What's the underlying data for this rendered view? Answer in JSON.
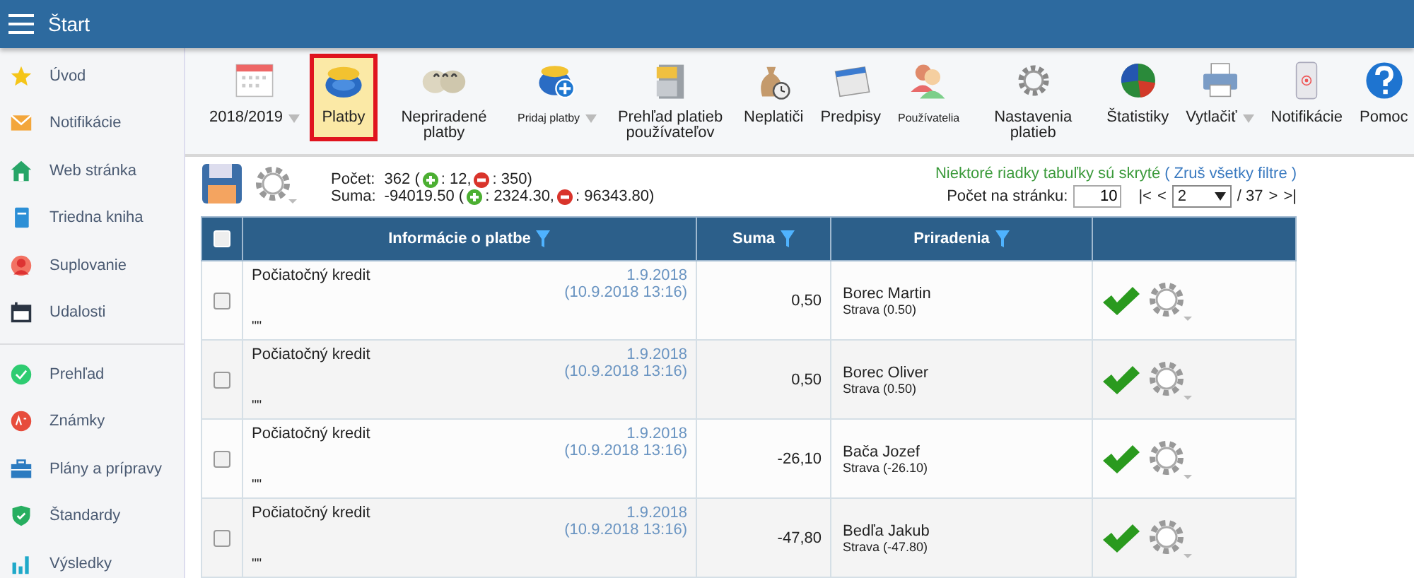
{
  "header": {
    "title": "Štart"
  },
  "sidebar": {
    "groups": [
      {
        "items": [
          {
            "label": "Úvod"
          },
          {
            "label": "Notifikácie"
          },
          {
            "label": "Web stránka"
          },
          {
            "label": "Triedna kniha"
          },
          {
            "label": "Suplovanie"
          },
          {
            "label": "Udalosti"
          }
        ]
      },
      {
        "items": [
          {
            "label": "Prehľad"
          },
          {
            "label": "Známky"
          },
          {
            "label": "Plány a prípravy"
          },
          {
            "label": "Štandardy"
          },
          {
            "label": "Výsledky"
          }
        ]
      }
    ]
  },
  "toolbar": [
    {
      "label": "2018/2019",
      "selected": false,
      "dropdown": true,
      "small": false
    },
    {
      "label": "Platby",
      "selected": true,
      "dropdown": false,
      "small": false
    },
    {
      "label": "Nepriradené platby",
      "selected": false,
      "dropdown": false,
      "small": false
    },
    {
      "label": "Pridaj platby",
      "selected": false,
      "dropdown": true,
      "small": true
    },
    {
      "label": "Prehľad platieb používateľov",
      "selected": false,
      "dropdown": false,
      "small": false
    },
    {
      "label": "Neplatiči",
      "selected": false,
      "dropdown": false,
      "small": false
    },
    {
      "label": "Predpisy",
      "selected": false,
      "dropdown": false,
      "small": false
    },
    {
      "label": "Používatelia",
      "selected": false,
      "dropdown": false,
      "small": true
    },
    {
      "label": "Nastavenia platieb",
      "selected": false,
      "dropdown": false,
      "small": false
    },
    {
      "label": "Štatistiky",
      "selected": false,
      "dropdown": false,
      "small": false
    },
    {
      "label": "Vytlačiť",
      "selected": false,
      "dropdown": true,
      "small": false
    },
    {
      "label": "Notifikácie",
      "selected": false,
      "dropdown": false,
      "small": false
    },
    {
      "label": "Pomoc",
      "selected": false,
      "dropdown": false,
      "small": false
    }
  ],
  "summary": {
    "count_label": "Počet:",
    "count": "362 (",
    "count_plus": ": 12,",
    "count_minus": ": 350)",
    "sum_label": "Suma:",
    "sum": "-94019.50 (",
    "sum_plus": ": 2324.30,",
    "sum_minus": ": 96343.80)"
  },
  "filter_notice": {
    "text": "Niektoré riadky tabuľky sú skryté",
    "link_open": "(",
    "link": "Zruš všetky filtre",
    "link_close": ")"
  },
  "pager": {
    "per_page_label": "Počet na stránku:",
    "per_page": "10",
    "first": "|<",
    "prev": "<",
    "page": "2",
    "total": "/ 37",
    "next": ">",
    "last": ">|"
  },
  "table": {
    "select_all": false,
    "columns": [
      {
        "label": "Informácie o platbe",
        "filter": true
      },
      {
        "label": "Suma",
        "filter": true
      },
      {
        "label": "Priradenia",
        "filter": true
      }
    ],
    "rows": [
      {
        "checked": false,
        "title": "Počiatočný kredit",
        "note": "\"\"",
        "date": "1.9.2018",
        "created": "(10.9.2018 13:16)",
        "amount": "0,50",
        "person": "Borec Martin",
        "assignment": "Strava (0.50)",
        "confirmed": true
      },
      {
        "checked": false,
        "title": "Počiatočný kredit",
        "note": "\"\"",
        "date": "1.9.2018",
        "created": "(10.9.2018 13:16)",
        "amount": "0,50",
        "person": "Borec Oliver",
        "assignment": "Strava (0.50)",
        "confirmed": true
      },
      {
        "checked": false,
        "title": "Počiatočný kredit",
        "note": "\"\"",
        "date": "1.9.2018",
        "created": "(10.9.2018 13:16)",
        "amount": "-26,10",
        "person": "Bača Jozef",
        "assignment": "Strava (-26.10)",
        "confirmed": true
      },
      {
        "checked": false,
        "title": "Počiatočný kredit",
        "note": "\"\"",
        "date": "1.9.2018",
        "created": "(10.9.2018 13:16)",
        "amount": "-47,80",
        "person": "Bedľa Jakub",
        "assignment": "Strava (-47.80)",
        "confirmed": true
      }
    ]
  }
}
